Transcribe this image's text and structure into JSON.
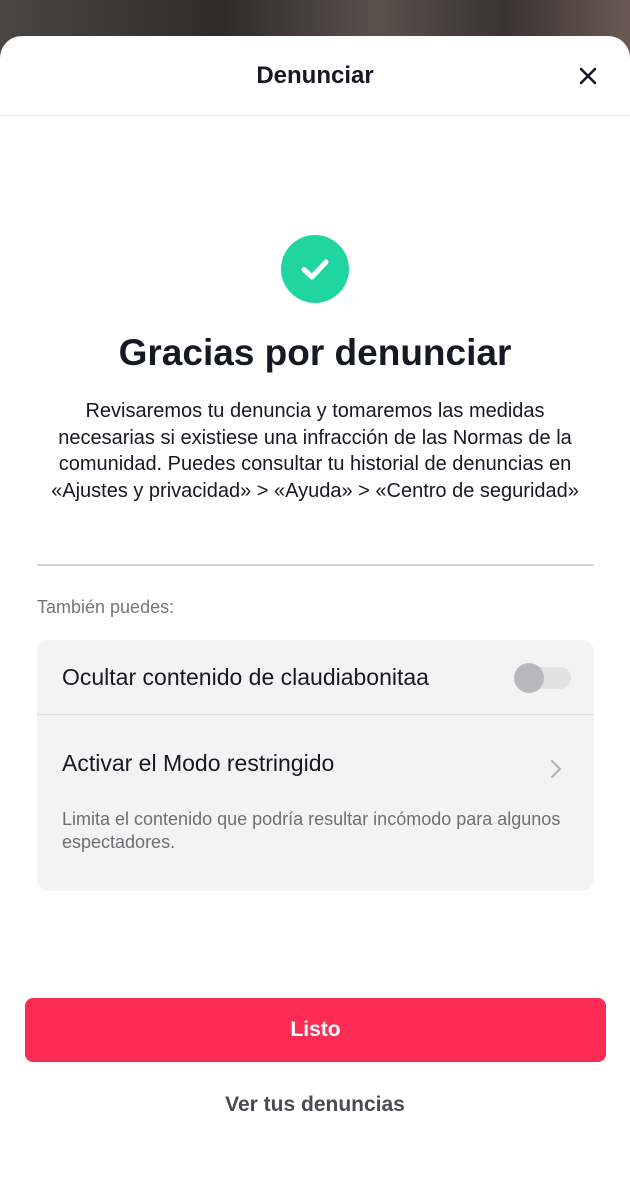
{
  "header": {
    "title": "Denunciar"
  },
  "confirmation": {
    "title": "Gracias por denunciar",
    "description": "Revisaremos tu denuncia y tomaremos las medidas necesarias si existiese una infracción de las Normas de la comunidad. Puedes consultar tu historial de denuncias en «Ajustes y privacidad» > «Ayuda» > «Centro de seguridad»"
  },
  "options": {
    "section_label": "También puedes:",
    "hide_content": {
      "label": "Ocultar contenido de claudiabonitaa",
      "enabled": false
    },
    "restricted_mode": {
      "label": "Activar el Modo restringido",
      "description": "Limita el contenido que podría resultar incómodo para algunos espectadores."
    }
  },
  "actions": {
    "done_label": "Listo",
    "view_reports_label": "Ver tus denuncias"
  },
  "colors": {
    "accent": "#fe2c55",
    "success": "#20d5a0",
    "text": "#161823"
  }
}
